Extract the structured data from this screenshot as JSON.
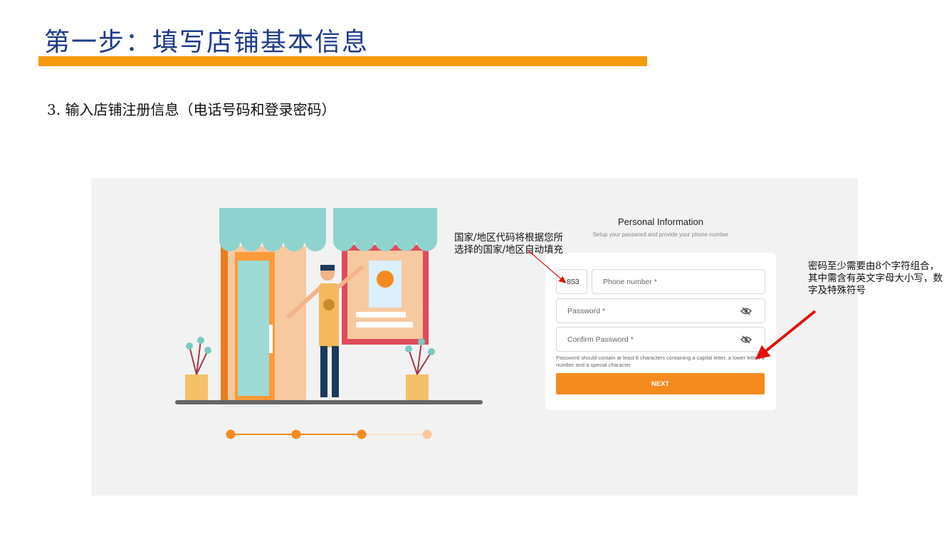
{
  "slide": {
    "title": "第一步：填写店铺基本信息",
    "step": "3. 输入店铺注册信息（电话号码和登录密码）"
  },
  "form": {
    "title": "Personal Information",
    "subtitle": "Setup your password and provide your phone number",
    "country_code": "+853",
    "phone_placeholder": "Phone number *",
    "password_placeholder": "Password *",
    "confirm_placeholder": "Confirm Password *",
    "hint": "Password should contain at least 8 characters containing a capital letter, a lower letter, a number and a special character",
    "next_label": "NEXT",
    "eye_icon": "eye-off-icon"
  },
  "progress": {
    "total_steps": 4,
    "completed_steps": 3
  },
  "annotations": {
    "country_note": "国家/地区代码将根据您所选择的国家/地区自动填充",
    "password_note": "密码至少需要由8个字符组合，其中需含有英文字母大小写，数字及特殊符号"
  },
  "colors": {
    "accent": "#f58a1f",
    "title_bar": "#f59a0c",
    "title_text": "#1f3a8a",
    "arrow": "#e01010"
  }
}
